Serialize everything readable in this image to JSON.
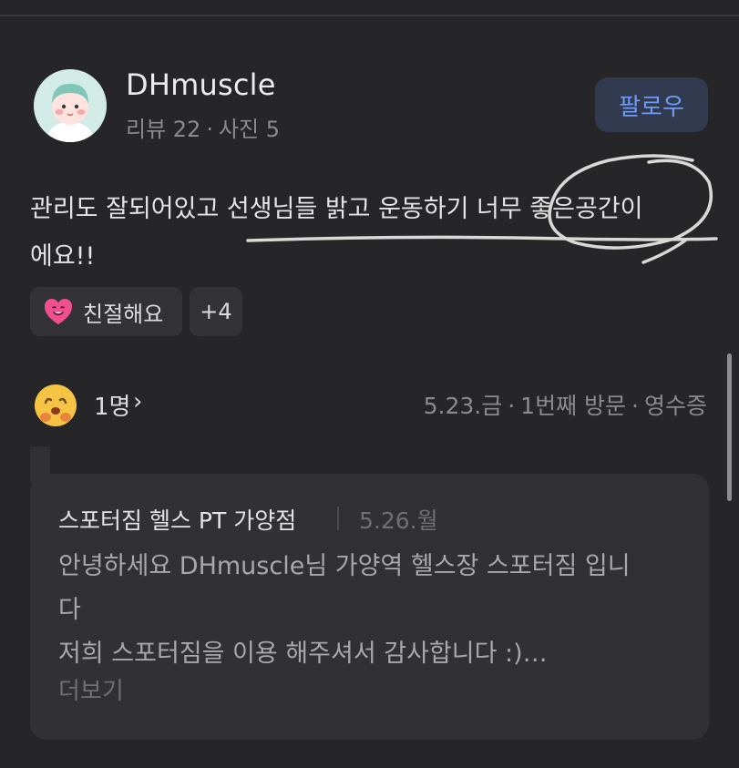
{
  "user": {
    "name": "DHmuscle",
    "review_label": "리뷰 22",
    "meta_separator": "·",
    "photo_label": "사진 5"
  },
  "follow_label": "팔로우",
  "review": {
    "line1": "관리도 잘되어있고 선생님들 밝고 운동하기 너무 좋은공간이",
    "line2": "에요!!"
  },
  "tags": {
    "kind_label": "친절해요",
    "more_label": "+4"
  },
  "reaction": {
    "count_label": "1명",
    "chevron": "›"
  },
  "visit": {
    "date": "5.23.금",
    "order": "1번째 방문",
    "receipt": "영수증",
    "separator": "·"
  },
  "owner_reply": {
    "store_name": "스포터짐 헬스 PT 가양점",
    "date": "5.26.월",
    "line1": "안녕하세요 DHmuscle님 가양역 헬스장 스포터짐 입니",
    "line2": "다",
    "line3": "저희 스포터짐을 이용 해주셔서 감사합니다 :)…",
    "more_label": "더보기"
  },
  "colors": {
    "background": "#262629",
    "follow_text": "#6f9cf2",
    "follow_bg": "#313a4f",
    "card_bg": "#313135"
  }
}
